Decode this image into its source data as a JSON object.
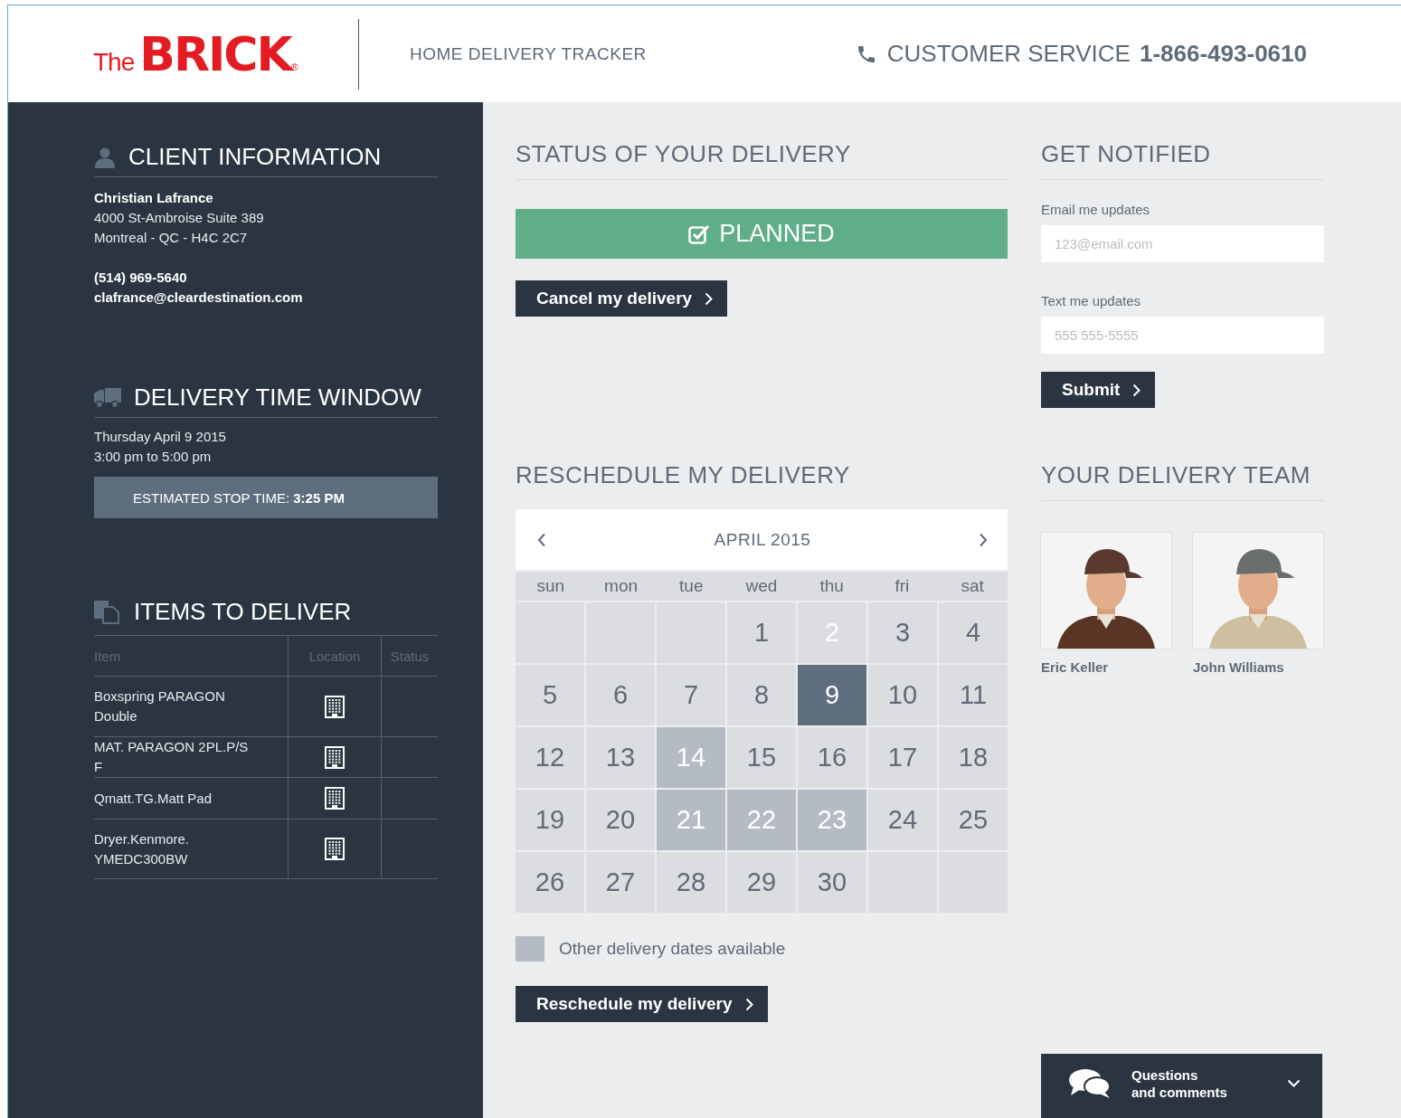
{
  "header": {
    "logo": {
      "prefix": "The",
      "name": "BRICK",
      "mark": "®"
    },
    "title": "HOME DELIVERY TRACKER",
    "service_label": "CUSTOMER SERVICE",
    "service_phone": "1-866-493-0610"
  },
  "sidebar": {
    "client": {
      "title": "CLIENT INFORMATION",
      "name": "Christian Lafrance",
      "address": [
        "4000 St-Ambroise Suite 389",
        "Montreal - QC - H4C 2C7"
      ],
      "phone": "(514) 969-5640",
      "email": "clafrance@cleardestination.com"
    },
    "time_window": {
      "title": "DELIVERY TIME WINDOW",
      "date": "Thursday April 9 2015",
      "hours": "3:00 pm to 5:00 pm",
      "estimate": "ESTIMATED STOP TIME: **3:25 PM**"
    },
    "items": {
      "title": "ITEMS TO DELIVER",
      "columns": [
        "Item",
        "Location",
        "Status"
      ],
      "rows": [
        {
          "item": "Boxspring PARAGON Double"
        },
        {
          "item": "MAT. PARAGON 2PL.P/S F"
        },
        {
          "item": "Qmatt.TG.Matt Pad"
        },
        {
          "item": "Dryer.Kenmore. YMEDC300BW"
        }
      ]
    }
  },
  "status": {
    "title": "STATUS OF YOUR DELIVERY",
    "state": "PLANNED",
    "cancel_button": "Cancel my delivery"
  },
  "notify": {
    "title": "GET NOTIFIED",
    "email_label": "Email me updates",
    "email_placeholder": "123@email.com",
    "text_label": "Text me updates",
    "text_placeholder": "555 555-5555",
    "submit_button": "Submit"
  },
  "reschedule": {
    "title": "RESCHEDULE MY DELIVERY",
    "month": "APRIL 2015",
    "weekdays": [
      "sun",
      "mon",
      "tue",
      "wed",
      "thu",
      "fri",
      "sat"
    ],
    "days": [
      {
        "kind": "empty"
      },
      {
        "kind": "empty"
      },
      {
        "kind": "empty"
      },
      {
        "kind": "day",
        "label": "1",
        "selected": false,
        "available": false
      },
      {
        "kind": "blocked",
        "label": "2",
        "selected": false,
        "available": false
      },
      {
        "kind": "day",
        "label": "3",
        "selected": false,
        "available": false
      },
      {
        "kind": "day",
        "label": "4",
        "selected": false,
        "available": false
      },
      {
        "kind": "day",
        "label": "5",
        "selected": false,
        "available": false
      },
      {
        "kind": "day",
        "label": "6",
        "selected": false,
        "available": false
      },
      {
        "kind": "day",
        "label": "7",
        "selected": false,
        "available": false
      },
      {
        "kind": "day",
        "label": "8",
        "selected": false,
        "available": false
      },
      {
        "kind": "day",
        "label": "9",
        "selected": true,
        "available": false
      },
      {
        "kind": "day",
        "label": "10",
        "selected": false,
        "available": false
      },
      {
        "kind": "day",
        "label": "11",
        "selected": false,
        "available": false
      },
      {
        "kind": "day",
        "label": "12",
        "selected": false,
        "available": false
      },
      {
        "kind": "day",
        "label": "13",
        "selected": false,
        "available": false
      },
      {
        "kind": "day",
        "label": "14",
        "selected": false,
        "available": true
      },
      {
        "kind": "day",
        "label": "15",
        "selected": false,
        "available": false
      },
      {
        "kind": "day",
        "label": "16",
        "selected": false,
        "available": false
      },
      {
        "kind": "day",
        "label": "17",
        "selected": false,
        "available": false
      },
      {
        "kind": "day",
        "label": "18",
        "selected": false,
        "available": false
      },
      {
        "kind": "day",
        "label": "19",
        "selected": false,
        "available": false
      },
      {
        "kind": "day",
        "label": "20",
        "selected": false,
        "available": false
      },
      {
        "kind": "day",
        "label": "21",
        "selected": false,
        "available": true
      },
      {
        "kind": "day",
        "label": "22",
        "selected": false,
        "available": true
      },
      {
        "kind": "day",
        "label": "23",
        "selected": false,
        "available": true
      },
      {
        "kind": "day",
        "label": "24",
        "selected": false,
        "available": false
      },
      {
        "kind": "day",
        "label": "25",
        "selected": false,
        "available": false
      },
      {
        "kind": "day",
        "label": "26",
        "selected": false,
        "available": false
      },
      {
        "kind": "day",
        "label": "27",
        "selected": false,
        "available": false
      },
      {
        "kind": "day",
        "label": "28",
        "selected": false,
        "available": false
      },
      {
        "kind": "day",
        "label": "29",
        "selected": false,
        "available": false
      },
      {
        "kind": "day",
        "label": "30",
        "selected": false,
        "available": false
      },
      {
        "kind": "empty"
      },
      {
        "kind": "empty"
      }
    ],
    "legend": "Other delivery dates available",
    "button": "Reschedule my delivery"
  },
  "team": {
    "title": "YOUR DELIVERY TEAM",
    "members": [
      {
        "name": "Eric Keller"
      },
      {
        "name": "John Williams"
      }
    ]
  },
  "chat": {
    "label": [
      "Questions",
      "and comments"
    ]
  }
}
